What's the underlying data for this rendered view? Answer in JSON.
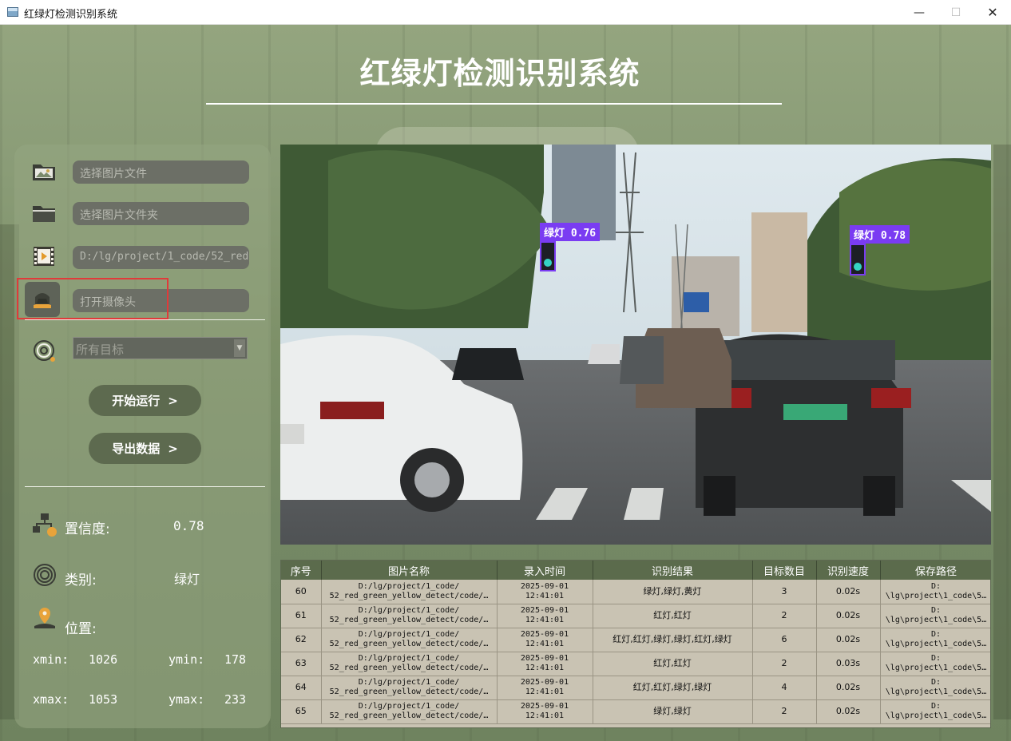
{
  "window": {
    "title": "红绿灯检测识别系统",
    "controls": {
      "minimize": "—",
      "maximize": "☐",
      "close": "✕"
    }
  },
  "header": {
    "title": "红绿灯检测识别系统"
  },
  "left_panel": {
    "image_file": {
      "placeholder": "选择图片文件",
      "icon": "image-folder-icon"
    },
    "image_folder": {
      "placeholder": "选择图片文件夹",
      "icon": "folder-icon"
    },
    "video_file": {
      "value": "D:/lg/project/1_code/52_red",
      "icon": "video-file-icon"
    },
    "camera": {
      "placeholder": "打开摄像头",
      "icon": "camera-icon"
    },
    "target_select": {
      "value": "所有目标",
      "icon": "target-icon"
    },
    "start_button": {
      "label": "开始运行",
      "chevron": ">"
    },
    "export_button": {
      "label": "导出数据",
      "chevron": ">"
    },
    "confidence": {
      "label": "置信度:",
      "value": "0.78"
    },
    "class": {
      "label": "类别:",
      "value": "绿灯"
    },
    "position": {
      "label": "位置:",
      "xmin_label": "xmin:",
      "xmin": "1026",
      "ymin_label": "ymin:",
      "ymin": "178",
      "xmax_label": "xmax:",
      "xmax": "1053",
      "ymax_label": "ymax:",
      "ymax": "233"
    }
  },
  "viewer": {
    "detections": [
      {
        "label": "绿灯 0.76"
      },
      {
        "label": "绿灯 0.78"
      }
    ]
  },
  "table": {
    "headers": [
      "序号",
      "图片名称",
      "录入时间",
      "识别结果",
      "目标数目",
      "识别速度",
      "保存路径"
    ],
    "rows": [
      {
        "id": "60",
        "name_1": "D:/lg/project/1_code/",
        "name_2": "52_red_green_yellow_detect/code/…",
        "date": "2025-09-01",
        "time": "12:41:01",
        "result": "绿灯,绿灯,黄灯",
        "count": "3",
        "speed": "0.02s",
        "path_1": "D:",
        "path_2": "\\lg\\project\\1_code\\5…"
      },
      {
        "id": "61",
        "name_1": "D:/lg/project/1_code/",
        "name_2": "52_red_green_yellow_detect/code/…",
        "date": "2025-09-01",
        "time": "12:41:01",
        "result": "红灯,红灯",
        "count": "2",
        "speed": "0.02s",
        "path_1": "D:",
        "path_2": "\\lg\\project\\1_code\\5…"
      },
      {
        "id": "62",
        "name_1": "D:/lg/project/1_code/",
        "name_2": "52_red_green_yellow_detect/code/…",
        "date": "2025-09-01",
        "time": "12:41:01",
        "result": "红灯,红灯,绿灯,绿灯,红灯,绿灯",
        "count": "6",
        "speed": "0.02s",
        "path_1": "D:",
        "path_2": "\\lg\\project\\1_code\\5…"
      },
      {
        "id": "63",
        "name_1": "D:/lg/project/1_code/",
        "name_2": "52_red_green_yellow_detect/code/…",
        "date": "2025-09-01",
        "time": "12:41:01",
        "result": "红灯,红灯",
        "count": "2",
        "speed": "0.03s",
        "path_1": "D:",
        "path_2": "\\lg\\project\\1_code\\5…"
      },
      {
        "id": "64",
        "name_1": "D:/lg/project/1_code/",
        "name_2": "52_red_green_yellow_detect/code/…",
        "date": "2025-09-01",
        "time": "12:41:01",
        "result": "红灯,红灯,绿灯,绿灯",
        "count": "4",
        "speed": "0.02s",
        "path_1": "D:",
        "path_2": "\\lg\\project\\1_code\\5…"
      },
      {
        "id": "65",
        "name_1": "D:/lg/project/1_code/",
        "name_2": "52_red_green_yellow_detect/code/…",
        "date": "2025-09-01",
        "time": "12:41:01",
        "result": "绿灯,绿灯",
        "count": "2",
        "speed": "0.02s",
        "path_1": "D:",
        "path_2": "\\lg\\project\\1_code\\5…"
      }
    ]
  },
  "colors": {
    "accent_pill": "#5d6a4f",
    "field_bg": "#6c6f66",
    "table_header": "#5b6b4c",
    "table_body": "#c9c3b3",
    "detection_box": "#7a3cf2",
    "highlight_border": "#e03a3a"
  }
}
